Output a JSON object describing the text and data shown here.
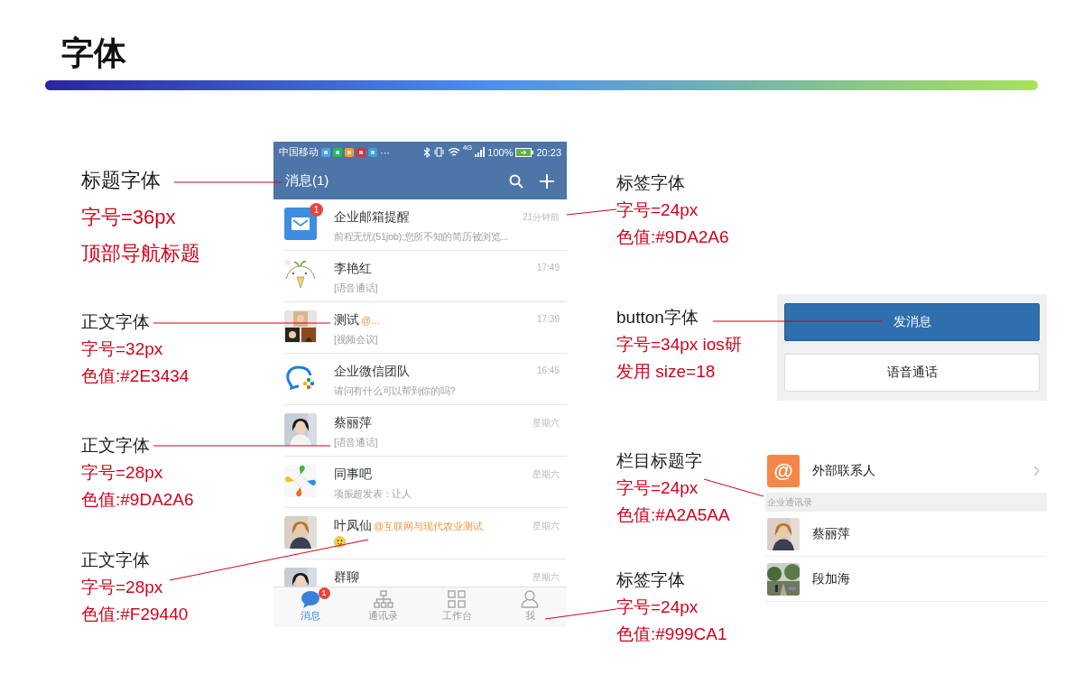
{
  "title": "字体",
  "annotations": [
    {
      "heading": "标题字体",
      "lines": [
        "字号=36px",
        "顶部导航标题"
      ]
    },
    {
      "heading": "正文字体",
      "lines": [
        "字号=32px",
        "色值:#2E3434"
      ]
    },
    {
      "heading": "正文字体",
      "lines": [
        "字号=28px",
        "色值:#9DA2A6"
      ]
    },
    {
      "heading": "正文字体",
      "lines": [
        "字号=28px",
        "色值:#F29440"
      ]
    },
    {
      "heading": "标签字体",
      "lines": [
        "字号=24px",
        "色值:#9DA2A6"
      ]
    },
    {
      "heading": "button字体",
      "lines": [
        "字号=34px ios研",
        "发用 size=18"
      ]
    },
    {
      "heading": "栏目标题字",
      "lines": [
        "字号=24px",
        "色值:#A2A5AA"
      ]
    },
    {
      "heading": "标签字体",
      "lines": [
        "字号=24px",
        "色值:#999CA1"
      ]
    }
  ],
  "phone": {
    "status_bar": {
      "carrier": "中国移动",
      "more": "···",
      "network": "4G",
      "battery": "100%",
      "time": "20:23"
    },
    "nav": {
      "title": "消息(1)"
    },
    "conversations": [
      {
        "kind": "text",
        "badge": "1",
        "name": "企业邮箱提醒",
        "preview": "前程无忧(51job):您所不知的简历被浏览...",
        "time": "21分钟前"
      },
      {
        "kind": "text",
        "name": "李艳红",
        "preview": "[语音通话]",
        "time": "17:49"
      },
      {
        "kind": "text",
        "name": "测试",
        "mention": "@...",
        "preview": "[视频会议]",
        "time": "17:39"
      },
      {
        "kind": "text",
        "name": "企业微信团队",
        "preview": "请问有什么可以帮到你的吗?",
        "time": "16:45"
      },
      {
        "kind": "text",
        "name": "蔡丽萍",
        "preview": "[语音通话]",
        "time": "星期六"
      },
      {
        "kind": "text",
        "name": "同事吧",
        "preview": "项振超发表：让人",
        "time": "星期六"
      },
      {
        "kind": "emoji",
        "name": "叶凤仙",
        "mention": "@互联网与现代农业测试",
        "time": "星期六"
      },
      {
        "kind": "plain",
        "name": "群聊",
        "time": "星期六"
      }
    ],
    "tabs": [
      {
        "label": "消息",
        "selected": true,
        "badge": "1"
      },
      {
        "label": "通讯录",
        "selected": false
      },
      {
        "label": "工作台",
        "selected": false
      },
      {
        "label": "我",
        "selected": false
      }
    ]
  },
  "button_panel": {
    "buttons": [
      {
        "label": "发消息",
        "kind": "primary"
      },
      {
        "label": "语音通话",
        "kind": "secondary"
      }
    ]
  },
  "contacts_panel": {
    "external": {
      "icon_char": "@",
      "label": "外部联系人"
    },
    "section": "企业通讯录",
    "contacts": [
      {
        "name": "蔡丽萍"
      },
      {
        "name": "段加海"
      }
    ]
  }
}
